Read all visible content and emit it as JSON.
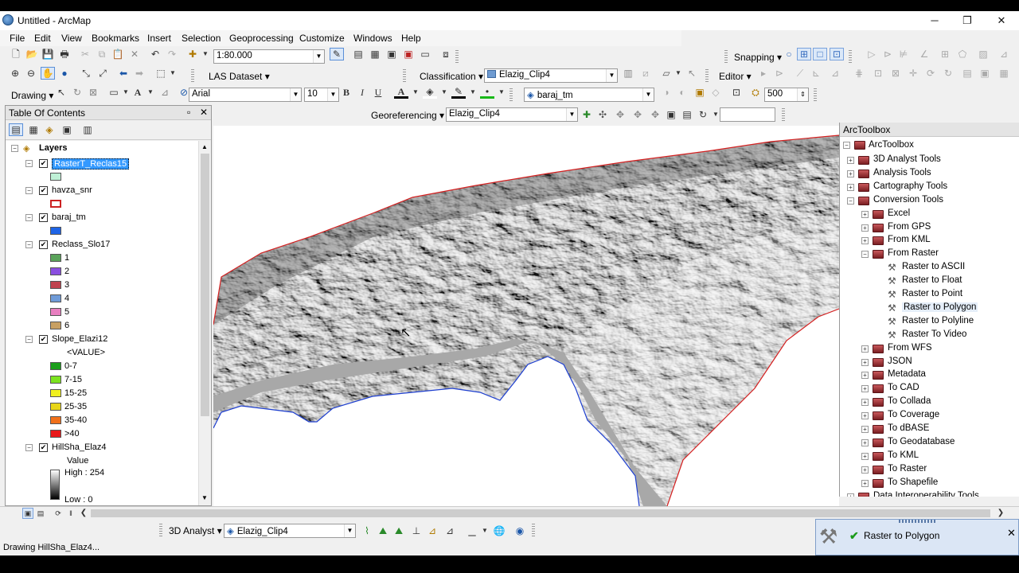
{
  "window": {
    "title": "Untitled - ArcMap",
    "minimize": "─",
    "restore": "❐",
    "close": "✕"
  },
  "menu": [
    "File",
    "Edit",
    "View",
    "Bookmarks",
    "Insert",
    "Selection",
    "Geoprocessing",
    "Customize",
    "Windows",
    "Help"
  ],
  "toolbar": {
    "scale": "1:80.000",
    "snapping_label": "Snapping ▾",
    "las_dataset": "LAS Dataset ▾",
    "classification": "Classification ▾",
    "classification_layer": "Elazig_Clip4",
    "editor": "Editor ▾",
    "drawing": "Drawing ▾",
    "font": "Arial",
    "font_size": "10",
    "bold": "B",
    "italic": "I",
    "underline": "U",
    "target_layer": "baraj_tm",
    "raster_size": "500",
    "georeferencing": "Georeferencing ▾",
    "georef_layer": "Elazig_Clip4",
    "georef_input": ""
  },
  "toc": {
    "title": "Table Of Contents",
    "pin": "▫",
    "close": "✕",
    "root": "Layers",
    "layers": [
      {
        "name": "RasterT_Reclas15",
        "checked": true,
        "selected": true,
        "swatches": [
          {
            "label": "",
            "color": "#bff0d6"
          }
        ]
      },
      {
        "name": "havza_snr",
        "checked": true,
        "swatches": [
          {
            "label": "",
            "color": "#ffffff",
            "outline": "#cc2222"
          }
        ]
      },
      {
        "name": "baraj_tm",
        "checked": true,
        "swatches": [
          {
            "label": "",
            "color": "#1e64e6"
          }
        ]
      },
      {
        "name": "Reclass_Slo17",
        "checked": true,
        "swatches": [
          {
            "label": "1",
            "color": "#5aa35a"
          },
          {
            "label": "2",
            "color": "#8a4fe0"
          },
          {
            "label": "3",
            "color": "#c0444f"
          },
          {
            "label": "4",
            "color": "#6f9bd8"
          },
          {
            "label": "5",
            "color": "#e87fc0"
          },
          {
            "label": "6",
            "color": "#c8a062"
          }
        ]
      },
      {
        "name": "Slope_Elazi12",
        "checked": true,
        "value_header": "<VALUE>",
        "swatches": [
          {
            "label": "0-7",
            "color": "#1a9e1a"
          },
          {
            "label": "7-15",
            "color": "#7ce31f"
          },
          {
            "label": "15-25",
            "color": "#f0f020"
          },
          {
            "label": "25-35",
            "color": "#e8d619"
          },
          {
            "label": "35-40",
            "color": "#f0701a"
          },
          {
            "label": ">40",
            "color": "#e8181a"
          }
        ]
      },
      {
        "name": "HillSha_Elaz4",
        "checked": true,
        "value_header": "Value",
        "high": "High : 254",
        "low": "Low : 0"
      }
    ]
  },
  "arctoolbox": {
    "title": "ArcToolbox",
    "root": "ArcToolbox",
    "items": [
      {
        "label": "3D Analyst Tools",
        "level": 1,
        "kind": "box",
        "open": false
      },
      {
        "label": "Analysis Tools",
        "level": 1,
        "kind": "box",
        "open": false
      },
      {
        "label": "Cartography Tools",
        "level": 1,
        "kind": "box",
        "open": false
      },
      {
        "label": "Conversion Tools",
        "level": 1,
        "kind": "box",
        "open": true
      },
      {
        "label": "Excel",
        "level": 2,
        "kind": "set",
        "open": false
      },
      {
        "label": "From GPS",
        "level": 2,
        "kind": "set",
        "open": false
      },
      {
        "label": "From KML",
        "level": 2,
        "kind": "set",
        "open": false
      },
      {
        "label": "From Raster",
        "level": 2,
        "kind": "set",
        "open": true
      },
      {
        "label": "Raster to ASCII",
        "level": 3,
        "kind": "tool"
      },
      {
        "label": "Raster to Float",
        "level": 3,
        "kind": "tool"
      },
      {
        "label": "Raster to Point",
        "level": 3,
        "kind": "tool"
      },
      {
        "label": "Raster to Polygon",
        "level": 3,
        "kind": "tool",
        "highlight": true
      },
      {
        "label": "Raster to Polyline",
        "level": 3,
        "kind": "tool"
      },
      {
        "label": "Raster To Video",
        "level": 3,
        "kind": "tool"
      },
      {
        "label": "From WFS",
        "level": 2,
        "kind": "set",
        "open": false
      },
      {
        "label": "JSON",
        "level": 2,
        "kind": "set",
        "open": false
      },
      {
        "label": "Metadata",
        "level": 2,
        "kind": "set",
        "open": false
      },
      {
        "label": "To CAD",
        "level": 2,
        "kind": "set",
        "open": false
      },
      {
        "label": "To Collada",
        "level": 2,
        "kind": "set",
        "open": false
      },
      {
        "label": "To Coverage",
        "level": 2,
        "kind": "set",
        "open": false
      },
      {
        "label": "To dBASE",
        "level": 2,
        "kind": "set",
        "open": false
      },
      {
        "label": "To Geodatabase",
        "level": 2,
        "kind": "set",
        "open": false
      },
      {
        "label": "To KML",
        "level": 2,
        "kind": "set",
        "open": false
      },
      {
        "label": "To Raster",
        "level": 2,
        "kind": "set",
        "open": false
      },
      {
        "label": "To Shapefile",
        "level": 2,
        "kind": "set",
        "open": false
      },
      {
        "label": "Data Interoperability Tools",
        "level": 1,
        "kind": "box",
        "open": false
      }
    ]
  },
  "bottom_toolbar": {
    "analyst_3d": "3D Analyst ▾",
    "layer": "Elazig_Clip4"
  },
  "notification": {
    "text": "Raster to Polygon",
    "close": "✕"
  },
  "status": {
    "text": "Drawing HillSha_Elaz4..."
  },
  "colors": {
    "boundary": "#d42020",
    "water": "#a8a8a8",
    "selection": "#3399ff"
  }
}
